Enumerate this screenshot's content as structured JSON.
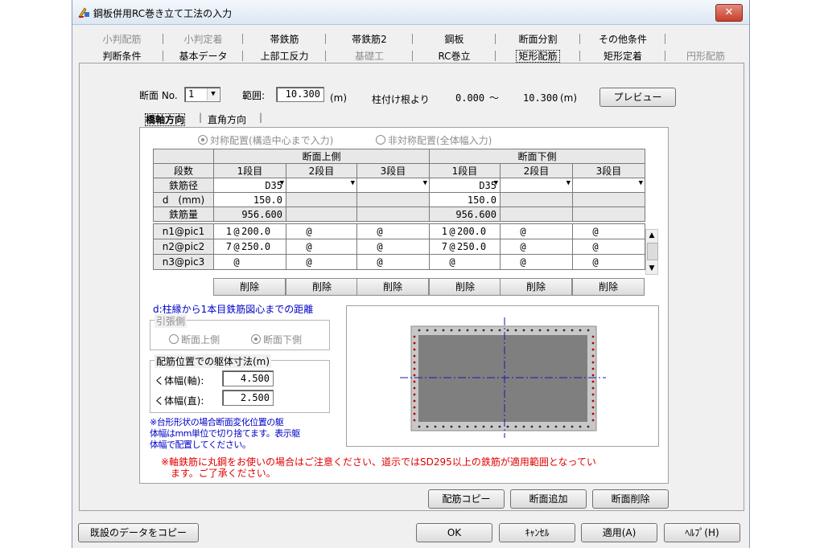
{
  "window": {
    "title": "鋼板併用RC巻き立て工法の入力",
    "close_label": "✕"
  },
  "tabs_row1": [
    {
      "label": "小判配筋",
      "disabled": true
    },
    {
      "label": "小判定着",
      "disabled": true
    },
    {
      "label": "帯鉄筋",
      "disabled": false
    },
    {
      "label": "帯鉄筋2",
      "disabled": false
    },
    {
      "label": "鋼板",
      "disabled": false
    },
    {
      "label": "断面分割",
      "disabled": false
    },
    {
      "label": "その他条件",
      "disabled": false
    }
  ],
  "tabs_row2": [
    {
      "label": "判断条件",
      "disabled": false
    },
    {
      "label": "基本データ",
      "disabled": false
    },
    {
      "label": "上部工反力",
      "disabled": false
    },
    {
      "label": "基礎工",
      "disabled": true
    },
    {
      "label": "RC巻立",
      "disabled": false
    },
    {
      "label": "矩形配筋",
      "disabled": false,
      "active": true
    },
    {
      "label": "矩形定着",
      "disabled": false
    },
    {
      "label": "円形配筋",
      "disabled": true
    }
  ],
  "section": {
    "no_label": "断面 No.",
    "no_value": "1",
    "range_label": "範囲:",
    "range_value": "10.300",
    "range_unit": "(m)",
    "from_label": "柱付け根より",
    "from_value": "0.000",
    "tilde": "～",
    "to_value": "10.300",
    "to_unit": "(m)",
    "preview_button": "プレビュー"
  },
  "direction_tabs": [
    "橋軸方向",
    "直角方向"
  ],
  "placement": {
    "symmetric": "対称配置(構造中心まで入力)",
    "asymmetric": "非対称配置(全体幅入力)"
  },
  "grid": {
    "upper_header": "断面上側",
    "lower_header": "断面下側",
    "row_label_header": "段数",
    "tiers": [
      "1段目",
      "2段目",
      "3段目",
      "1段目",
      "2段目",
      "3段目"
    ],
    "rows": {
      "diameter": {
        "label": "鉄筋径",
        "values": [
          "D35",
          "",
          "",
          "D35",
          "",
          ""
        ]
      },
      "d": {
        "label": "d　(mm)",
        "values": [
          "150.0",
          "",
          "",
          "150.0",
          "",
          ""
        ]
      },
      "amount": {
        "label": "鉄筋量",
        "values": [
          "956.600",
          "",
          "",
          "956.600",
          "",
          ""
        ]
      }
    },
    "pitch_rows": [
      {
        "label": "n1@pic1",
        "cells": [
          [
            "1",
            "200.0"
          ],
          [
            "",
            ""
          ],
          [
            "",
            ""
          ],
          [
            "1",
            "200.0"
          ],
          [
            "",
            ""
          ],
          [
            "",
            ""
          ]
        ]
      },
      {
        "label": "n2@pic2",
        "cells": [
          [
            "7",
            "250.0"
          ],
          [
            "",
            ""
          ],
          [
            "",
            ""
          ],
          [
            "7",
            "250.0"
          ],
          [
            "",
            ""
          ],
          [
            "",
            ""
          ]
        ]
      },
      {
        "label": "n3@pic3",
        "cells": [
          [
            "",
            ""
          ],
          [
            "",
            ""
          ],
          [
            "",
            ""
          ],
          [
            "",
            ""
          ],
          [
            "",
            ""
          ],
          [
            "",
            ""
          ]
        ]
      }
    ],
    "at_symbol": "@",
    "delete_label": "削除"
  },
  "notes": {
    "d_definition": "d:柱縁から1本目鉄筋図心までの距離",
    "tension_group": "引張側",
    "tension_upper": "断面上側",
    "tension_lower": "断面下側",
    "body_group": "配筋位置での躯体寸法(m)",
    "width_axis_label": "く体幅(軸):",
    "width_axis_value": "4.500",
    "width_perp_label": "く体幅(直):",
    "width_perp_value": "2.500",
    "trapezoid_note_1": "※台形形状の場合断面変化位置の躯",
    "trapezoid_note_2": "体幅はmm単位で切り捨てます。表示躯",
    "trapezoid_note_3": "体幅で配置してください。",
    "warning_1": "※軸鉄筋に丸鋼をお使いの場合はご注意ください、道示ではSD295以上の鉄筋が適用範囲となってい",
    "warning_2": "ます。ご了承ください。"
  },
  "buttons": {
    "copy_rebar": "配筋コピー",
    "add_section": "断面追加",
    "delete_section": "断面削除",
    "copy_existing": "既設のデータをコピー",
    "ok": "OK",
    "cancel": "ｷｬﾝｾﾙ",
    "apply": "適用(A)",
    "help": "ﾍﾙﾌﾟ(H)"
  },
  "colors": {
    "accent_blue": "#0000c8",
    "warning_red": "#e00000",
    "rebar_red": "#b00000",
    "concrete_fill": "#7f7f7f",
    "centerline": "#1a1aa8"
  }
}
